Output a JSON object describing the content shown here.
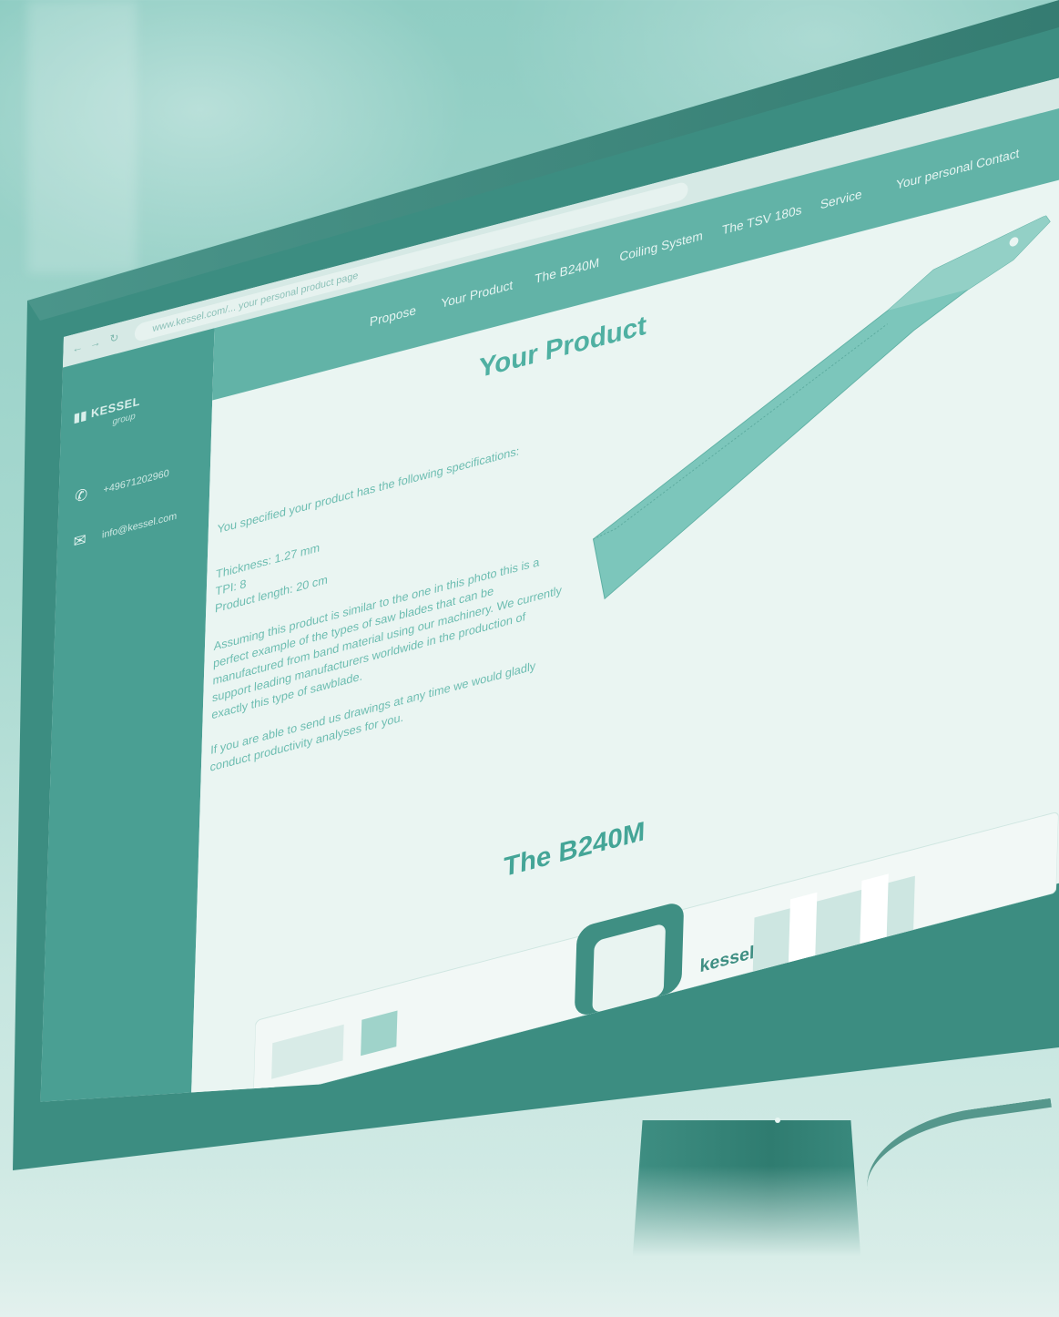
{
  "browser": {
    "back_glyph": "←",
    "forward_glyph": "→",
    "reload_glyph": "↻",
    "url": "www.kessel.com/... your personal product page"
  },
  "sidebar": {
    "logo": "KESSEL",
    "logo_sub": "group",
    "phone": "+49671202960",
    "email": "info@kessel.com",
    "icons": {
      "phone": "phone-icon",
      "email": "mail-icon"
    }
  },
  "nav": {
    "items": [
      {
        "label": "Propose"
      },
      {
        "label": "Your Product"
      },
      {
        "label": "The B240M"
      },
      {
        "label": "Coiling System"
      },
      {
        "label": "The TSV 180s"
      },
      {
        "label": "Service"
      },
      {
        "label": "Your personal Contact"
      }
    ]
  },
  "content": {
    "title": "Your Product",
    "intro": "You specified your product has the following specifications:",
    "specs": [
      "Thickness: 1.27 mm",
      "TPI: 8",
      "Product length: 20 cm"
    ],
    "body_lines": [
      "Assuming this product is similar to the one in this photo this is a",
      "perfect example of the types of saw blades that can be",
      "manufactured from band material using our machinery. We currently",
      "support leading manufacturers worldwide in the production of",
      "exactly this type of sawblade."
    ],
    "closing_lines": [
      "If you are able to send us drawings at any time we would gladly",
      "conduct productivity analyses for you."
    ],
    "section2_title": "The B240M",
    "machine_brand": "kessel"
  },
  "colors": {
    "accent": "#4fb0a2",
    "sidebar": "#4a9f93",
    "nav": "#62b3a7",
    "bezel": "#3c8d81"
  }
}
